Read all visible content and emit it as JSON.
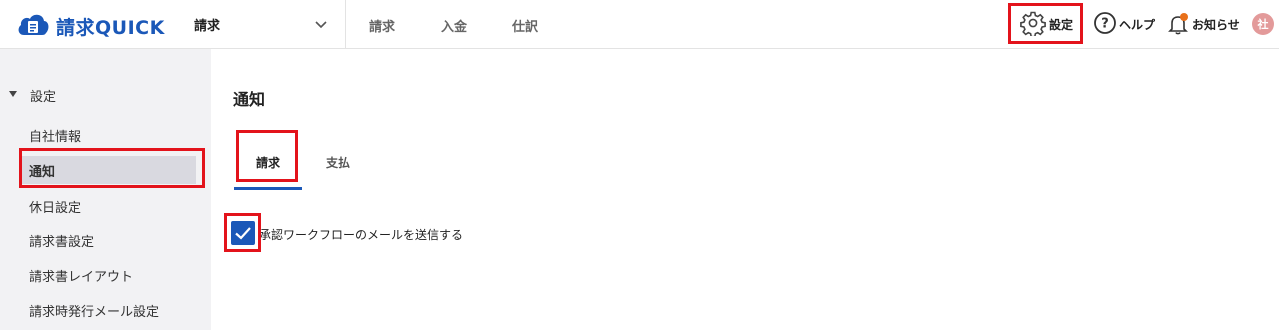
{
  "header": {
    "logo_text": "請求QUICK",
    "product_select": "請求",
    "nav": [
      "請求",
      "入金",
      "仕訳"
    ],
    "settings_label": "設定",
    "help_label": "ヘルプ",
    "notice_label": "お知らせ",
    "avatar_text": "社",
    "notice_dot_color": "#e8701a",
    "avatar_color": "#e39a9a"
  },
  "sidebar": {
    "parent_label": "設定",
    "items": [
      "自社情報",
      "通知",
      "休日設定",
      "請求書設定",
      "請求書レイアウト",
      "請求時発行メール設定"
    ],
    "active_item": "通知"
  },
  "main": {
    "title": "通知",
    "tabs": [
      "請求",
      "支払"
    ],
    "active_tab": "請求",
    "checkbox_label": "承認ワークフローのメールを送信する",
    "checkbox_checked": true
  },
  "colors": {
    "accent": "#1b58b8",
    "highlight": "#e3131b"
  }
}
